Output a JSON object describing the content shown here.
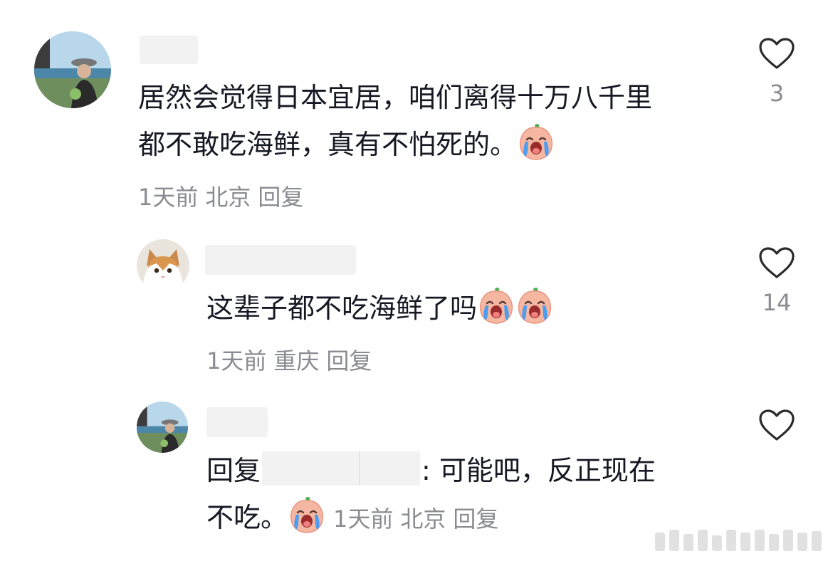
{
  "comments": [
    {
      "text_line1": "居然会觉得日本宜居，咱们离得十万八千里",
      "text_line2": "都不敢吃海鲜，真有不怕死的。",
      "time": "1天前",
      "location": "北京",
      "reply_label": "回复",
      "likes": "3",
      "avatar": "person-with-hat-avatar"
    },
    {
      "text": "这辈子都不吃海鲜了吗",
      "time": "1天前",
      "location": "重庆",
      "reply_label": "回复",
      "likes": "14",
      "avatar": "cat-avatar"
    },
    {
      "reply_prefix": "回复",
      "text_line1": ": 可能吧，反正现在",
      "text_line2": "不吃。",
      "time": "1天前",
      "location": "北京",
      "reply_label": "回复",
      "avatar": "person-with-hat-avatar"
    }
  ],
  "icons": {
    "like": "heart-outline-icon",
    "emoji": "crying-peach-emoji-icon"
  },
  "colors": {
    "text": "#161823",
    "meta": "#8a8b91",
    "heart_stroke": "#2b2b2b"
  }
}
